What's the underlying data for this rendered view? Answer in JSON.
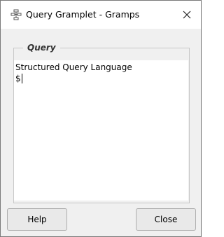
{
  "window": {
    "title": "Query Gramplet - Gramps",
    "icon": "gramps-app-icon"
  },
  "query_group": {
    "label": "Query",
    "lines": [
      "Structured Query Language",
      "$"
    ]
  },
  "buttons": {
    "help_label": "Help",
    "close_label": "Close"
  }
}
